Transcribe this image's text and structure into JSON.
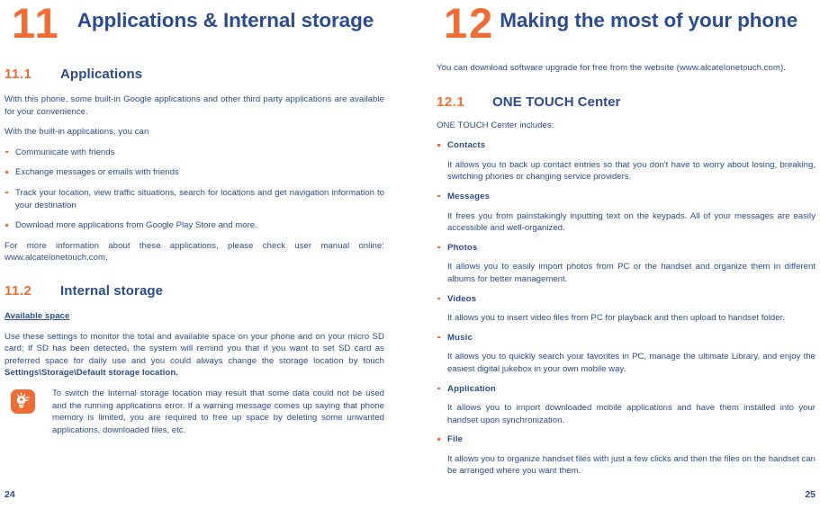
{
  "colors": {
    "accent_orange": "#ef6c33",
    "text_blue": "#2d4b8e",
    "page_background": "#ffffff"
  },
  "left_page": {
    "chapter_number": "11",
    "chapter_title": "Applications & Internal storage",
    "folio": "24",
    "sections": [
      {
        "number": "11.1",
        "title": "Applications",
        "paragraphs": [
          "With this phone, some built-in Google applications and other third party applications are available for your convenience.",
          "With the built-in applications, you can"
        ],
        "bullets": [
          "Communicate with friends",
          "Exchange messages or emails with friends",
          "Track your location, view traffic situations, search for locations and get navigation information to your destination",
          "Download more applications from Google Play Store and more."
        ],
        "closing_paragraph": "For more information about these applications, please check user manual  online: www.alcatelonetouch.com."
      },
      {
        "number": "11.2",
        "title": "Internal storage",
        "subheading": "Available space ",
        "body_lead": "Use these settings to monitor the total and available space on your phone and on your micro SD card; If SD has been detected, the system will remind you that if you want to set SD card as preferred space for daily use and you could always change the storage location by touch ",
        "body_bold": "Settings\\Storage\\Default storage location.",
        "tip": {
          "icon": "lightbulb-icon",
          "text": "To switch the Internal storage location may result that some data could not be used and the running applications error. If a warning message comes up saying that phone memory is limited, you are required to free up space by deleting some unwanted applications, downloaded files, etc."
        }
      }
    ]
  },
  "right_page": {
    "chapter_number": "12",
    "chapter_title": "Making the most of your phone",
    "folio": "25",
    "intro": "You can download software upgrade for free from the website (www.alcatelonetouch.com).",
    "section": {
      "number": "12.1",
      "title_bold": "ONE TOUCH",
      "title_rest": " Center",
      "lead": "ONE TOUCH Center includes:",
      "items": [
        {
          "term": "Contacts",
          "description": "It allows you to back up contact entries so that you don't have to worry about losing, breaking, switching phones or changing service providers."
        },
        {
          "term": "Messages",
          "description": "It frees you from painstakingly inputting text on the keypads. All of your messages are easily accessible and well-organized."
        },
        {
          "term": "Photos",
          "description": "It allows you to easily import photos from PC or the handset and organize them in different albums for better management."
        },
        {
          "term": "Videos",
          "description": "It allows you to insert video files from PC for playback and then upload to handset folder."
        },
        {
          "term": "Music",
          "description": "It allows you to quickly search your favorites in PC, manage the ultimate Library, and enjoy the easiest digital jukebox in your own mobile way."
        },
        {
          "term": "Application",
          "description": "It allows you to import downloaded mobile applications and have them installed into your handset upon synchronization."
        },
        {
          "term": "File",
          "description": "It allows you to organize handset files with just a few clicks and then the files on the handset can be arranged where you want them."
        }
      ]
    }
  }
}
